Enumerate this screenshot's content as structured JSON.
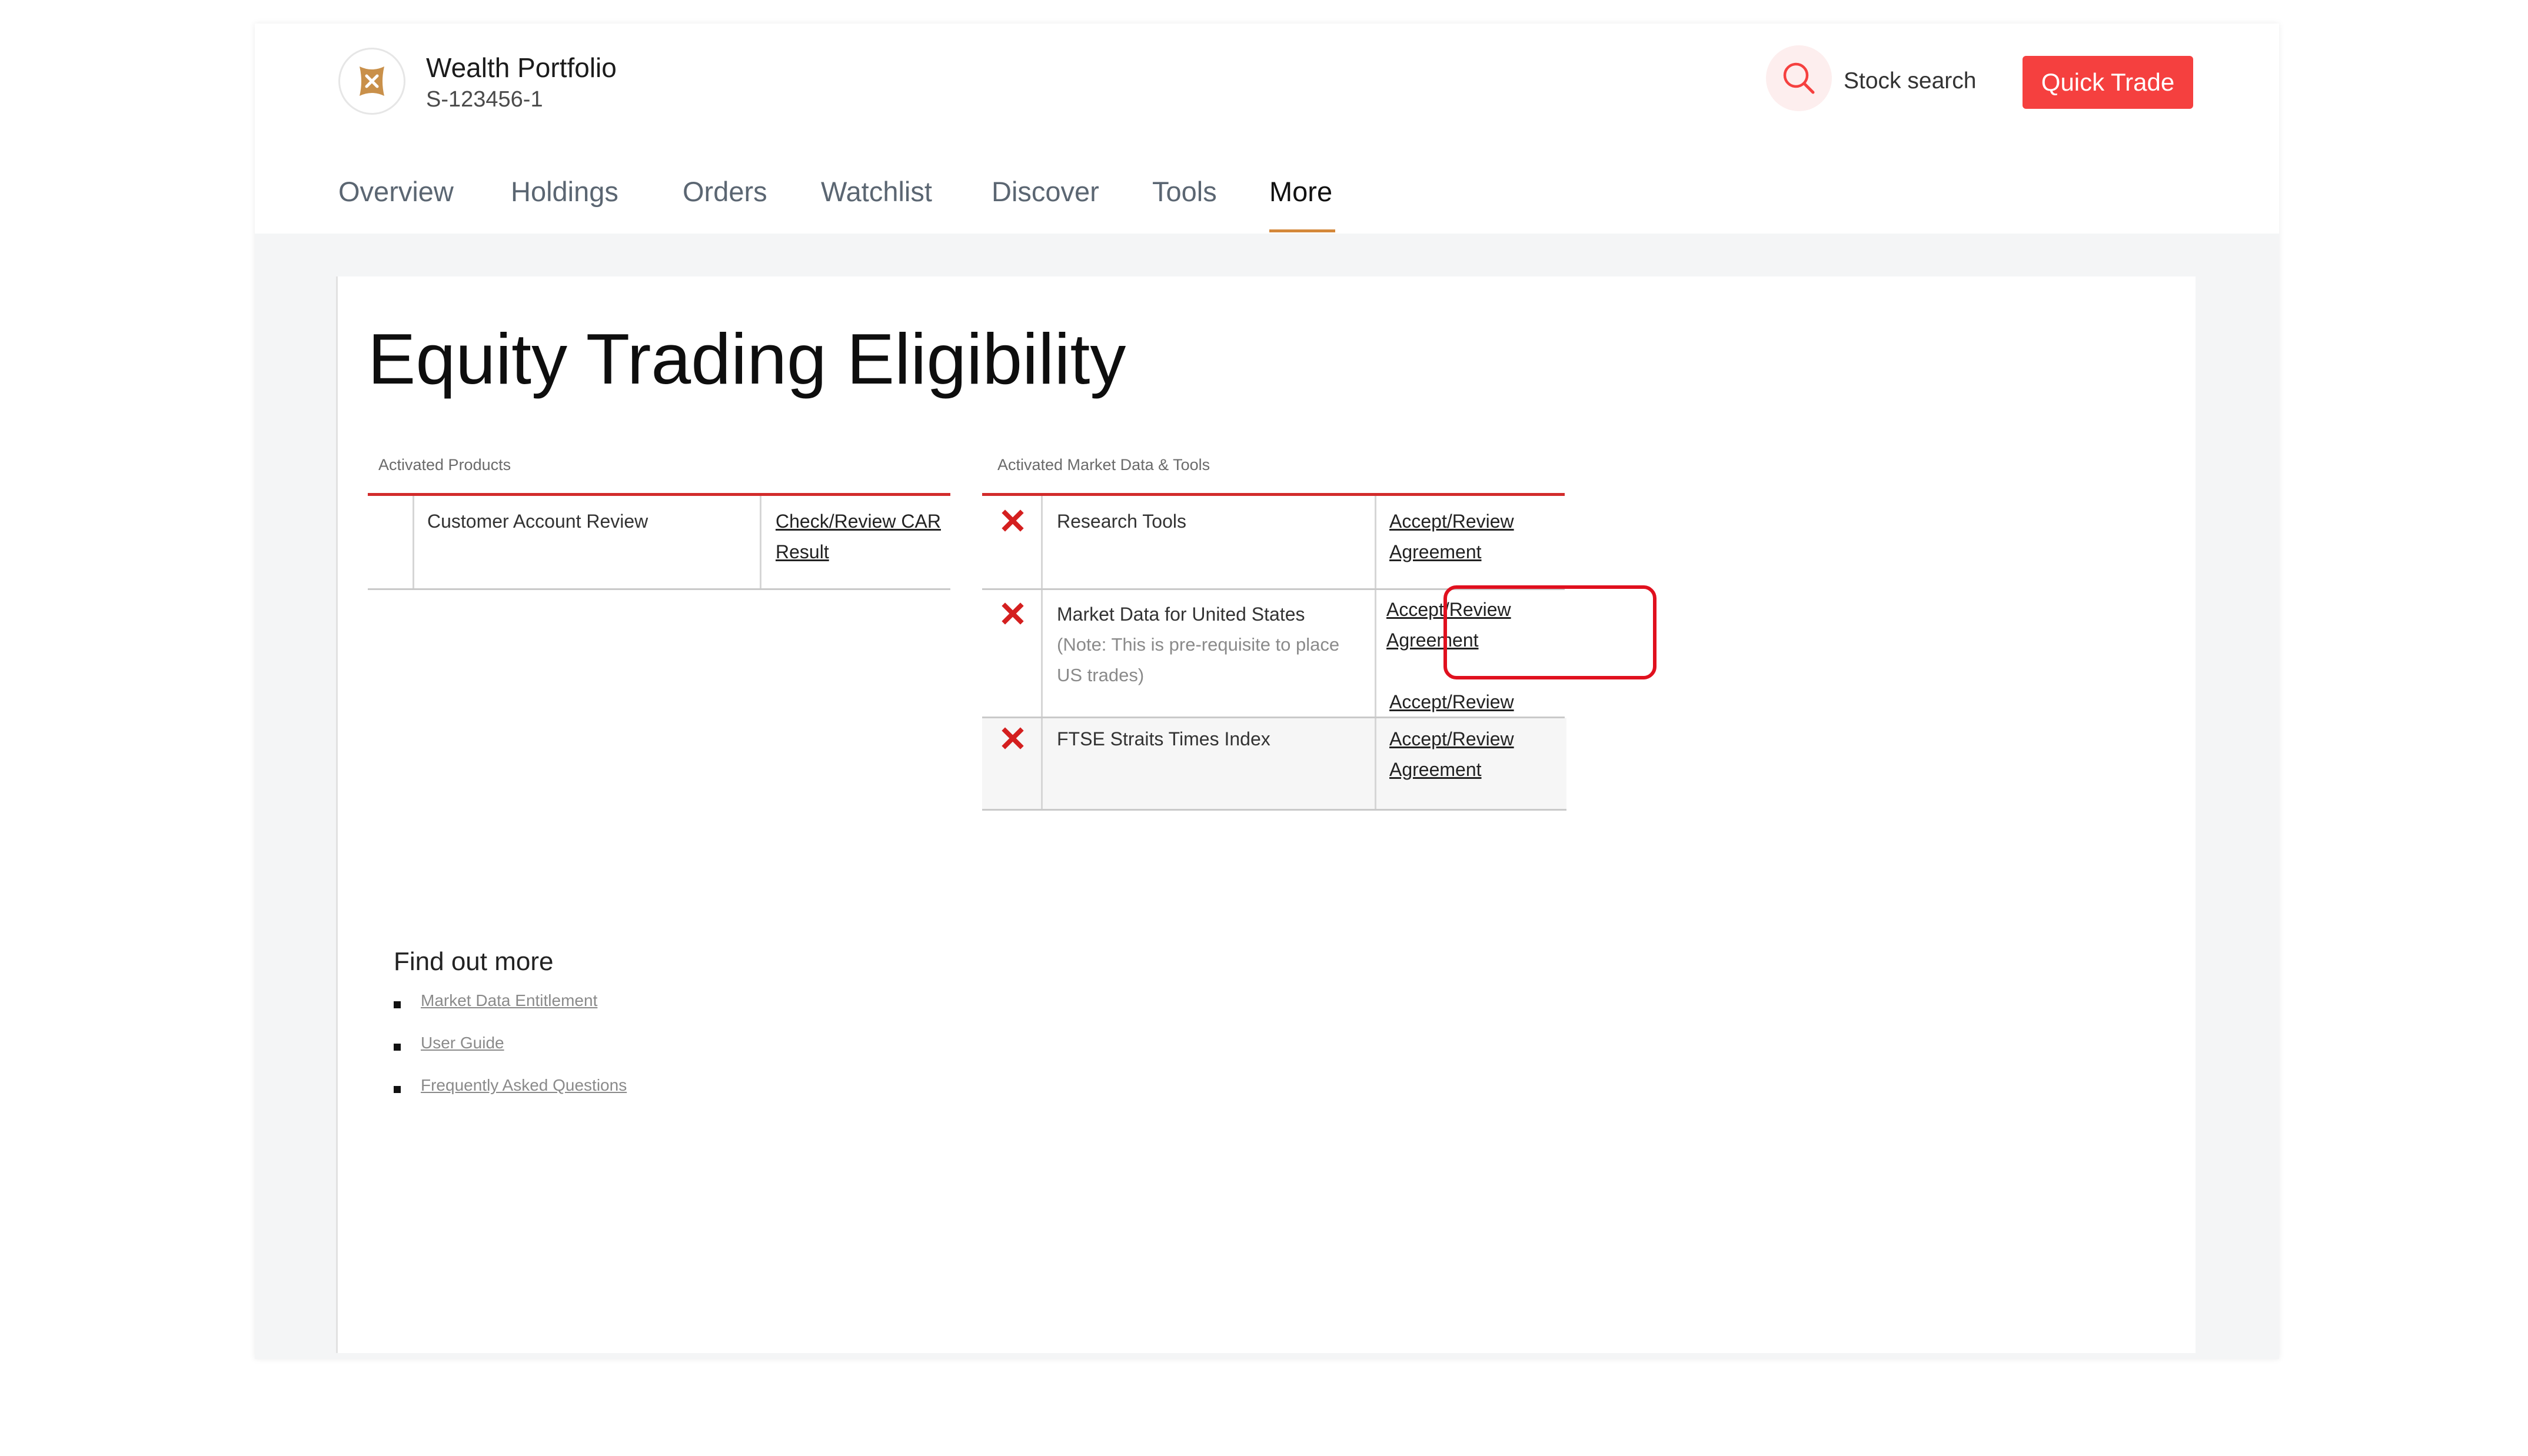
{
  "header": {
    "account_name": "Wealth Portfolio",
    "account_id": "S-123456-1",
    "search_label": "Stock search",
    "quick_trade_label": "Quick Trade"
  },
  "nav": {
    "tabs": [
      "Overview",
      "Holdings",
      "Orders",
      "Watchlist",
      "Discover",
      "Tools",
      "More"
    ],
    "active": "More"
  },
  "page": {
    "title": "Equity Trading Eligibility"
  },
  "activated_products": {
    "label": "Activated Products",
    "rows": [
      {
        "name": "Customer Account Review",
        "action_line1": "Check/Review CAR",
        "action_line2": "Result"
      }
    ]
  },
  "market_data": {
    "label": "Activated Market Data & Tools",
    "rows": [
      {
        "status": "not-activated",
        "name": "Research Tools",
        "note": "",
        "action_line1": "Accept/Review",
        "action_line2": "Agreement"
      },
      {
        "status": "not-activated",
        "name": "Market Data for United States",
        "note": "(Note: This is pre-requisite to place US trades)",
        "action_line1": "Accept/Review",
        "action_line2": "Agreement",
        "action_extra": "Accept/Review"
      },
      {
        "status": "not-activated",
        "name": "FTSE Straits Times Index",
        "note": "",
        "action_line1": "Accept/Review",
        "action_line2": "Agreement"
      }
    ]
  },
  "find_out_more": {
    "title": "Find out more",
    "links": [
      "Market Data Entitlement",
      "User Guide",
      "Frequently Asked Questions"
    ]
  },
  "colors": {
    "accent_red": "#f5403f",
    "table_red": "#d22b2b",
    "highlight_red": "#e0101e",
    "nav_underline": "#d4883a"
  },
  "icons": {
    "logo": "portfolio-logo-icon",
    "search": "search-icon",
    "status": "x-mark-icon"
  }
}
